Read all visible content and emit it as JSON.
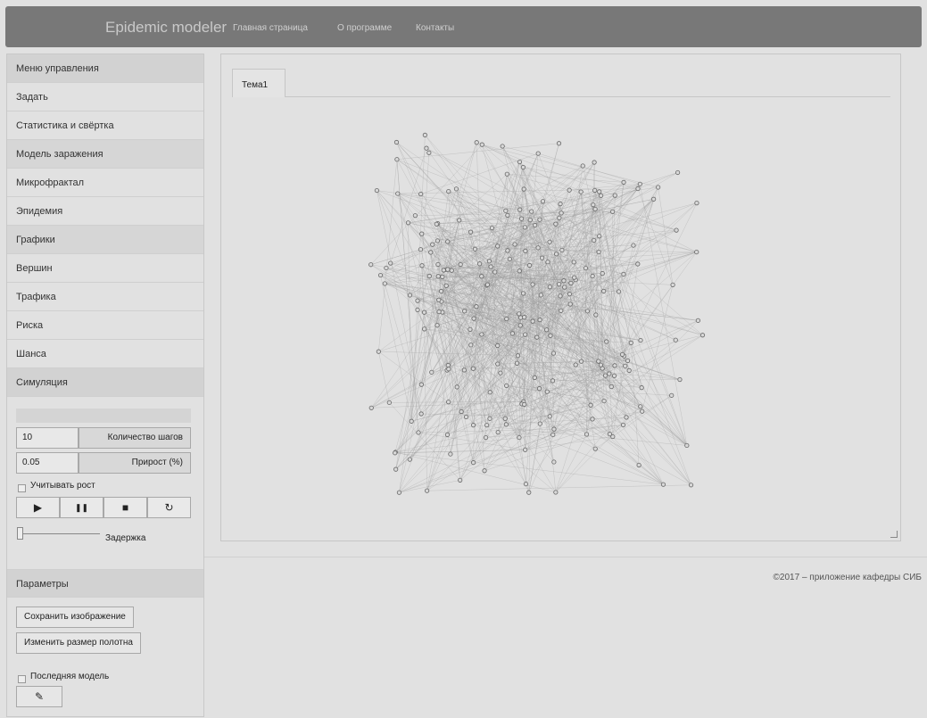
{
  "navbar": {
    "brand": "Epidemic modeler",
    "links": [
      "Главная страница",
      "О программе",
      "Контакты"
    ]
  },
  "sidebar": {
    "menu_header": "Меню управления",
    "items": [
      "Задать",
      "Статистика и свёртка",
      "Модель заражения",
      "Микрофрактал",
      "Эпидемия",
      "Графики",
      "Вершин",
      "Трафика",
      "Риска",
      "Шанса"
    ],
    "simulation_header": "Симуляция",
    "steps_value": "10",
    "steps_label": "Количество шагов",
    "growth_value": "0.05",
    "growth_label": "Прирост (%)",
    "growth_checkbox": "Учитывать рост",
    "delay_label": "Задержка",
    "params_header": "Параметры",
    "save_image": "Сохранить изображение",
    "resize_canvas": "Изменить размер полотна",
    "last_model": "Последняя модель"
  },
  "controls": {
    "play": "▶",
    "pause": "❚❚",
    "stop": "■",
    "reset": "↻",
    "edit": "✎"
  },
  "main": {
    "tab": "Тема1"
  },
  "footer": {
    "copyright": "©2017 – приложение кафедры СИБ"
  },
  "colors": {
    "navbar": "#787878",
    "background": "#e1e1e1",
    "node": "#8c8c8c",
    "edge": "#9b9b9b"
  }
}
